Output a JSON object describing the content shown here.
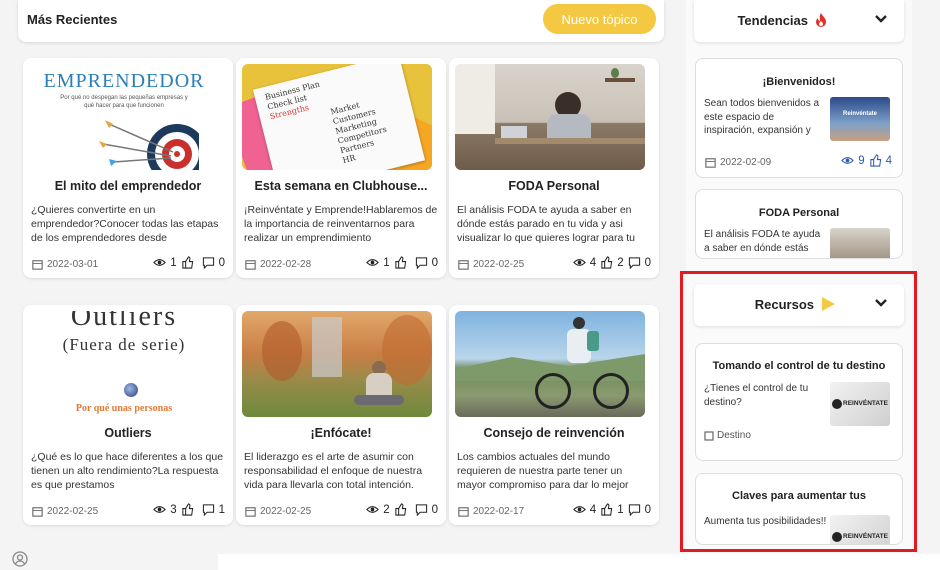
{
  "header": {
    "title": "Más Recientes",
    "new_topic_label": "Nuevo tópico"
  },
  "cards": [
    {
      "title": "El mito del emprendedor",
      "desc": "¿Quieres convertirte en un emprendedor?Conocer todas las etapas de los emprendedores desde",
      "date": "2022-03-01",
      "views": "1",
      "likes": "",
      "comments": "0",
      "thumb_heading": "EMPRENDEDOR",
      "thumb_sub": "Por qué no despegan las pequeñas empresas y qué hacer para que funcionen"
    },
    {
      "title": "Esta semana en Clubhouse...",
      "desc": "¡Reinvéntate y Emprende!Hablaremos de la importancia de reinventarnos para realizar un emprendimiento",
      "date": "2022-02-28",
      "views": "1",
      "likes": "",
      "comments": "0",
      "thumb_lines": [
        "Business Plan",
        "Check list",
        "Strengths",
        "Market",
        "Customers",
        "Marketing",
        "Competitors",
        "Partners",
        "HR"
      ]
    },
    {
      "title": "FODA Personal",
      "desc": "El análisis FODA te ayuda a saber en dónde estás parado en tu vida y asi visualizar lo que quieres lograr para tu",
      "date": "2022-02-25",
      "views": "4",
      "likes": "2",
      "comments": "0"
    },
    {
      "title": "Outliers",
      "desc": "¿Qué es lo que hace diferentes a los que tienen un alto rendimiento?La respuesta es que prestamos",
      "date": "2022-02-25",
      "views": "3",
      "likes": "",
      "comments": "1",
      "thumb_heading": "Outliers",
      "thumb_sub": "(Fuera de serie)",
      "thumb_caption": "Por qué unas personas"
    },
    {
      "title": "¡Enfócate!",
      "desc": "El liderazgo es el arte de asumir con responsabilidad el enfoque de nuestra vida para llevarla con total intención.",
      "date": "2022-02-25",
      "views": "2",
      "likes": "",
      "comments": "0"
    },
    {
      "title": "Consejo de reinvención",
      "desc": "Los cambios actuales del mundo requieren de nuestra parte tener un mayor compromiso para dar lo mejor",
      "date": "2022-02-17",
      "views": "4",
      "likes": "1",
      "comments": "0"
    }
  ],
  "tendencias": {
    "title": "Tendencias",
    "items": [
      {
        "title": "¡Bienvenidos!",
        "desc": "Sean todos bienvenidos a este espacio de inspiración, expansión y",
        "date": "2022-02-09",
        "views": "9",
        "likes": "4",
        "thumb_label": "Reinvéntate"
      },
      {
        "title": "FODA Personal",
        "desc": "El análisis FODA te ayuda a saber en dónde estás"
      }
    ]
  },
  "recursos": {
    "title": "Recursos",
    "items": [
      {
        "title": "Tomando el control de tu destino",
        "desc": "¿Tienes el control de tu destino?",
        "tag": "Destino",
        "thumb_label": "REINVÉNTATE"
      },
      {
        "title": "Claves para aumentar tus",
        "desc": "Aumenta tus posibilidades!!",
        "thumb_label": "REINVÉNTATE"
      }
    ]
  },
  "colors": {
    "accent": "#f5c842",
    "highlight": "#e01b22",
    "flame": "#e0322a",
    "play": "#f5c842"
  }
}
